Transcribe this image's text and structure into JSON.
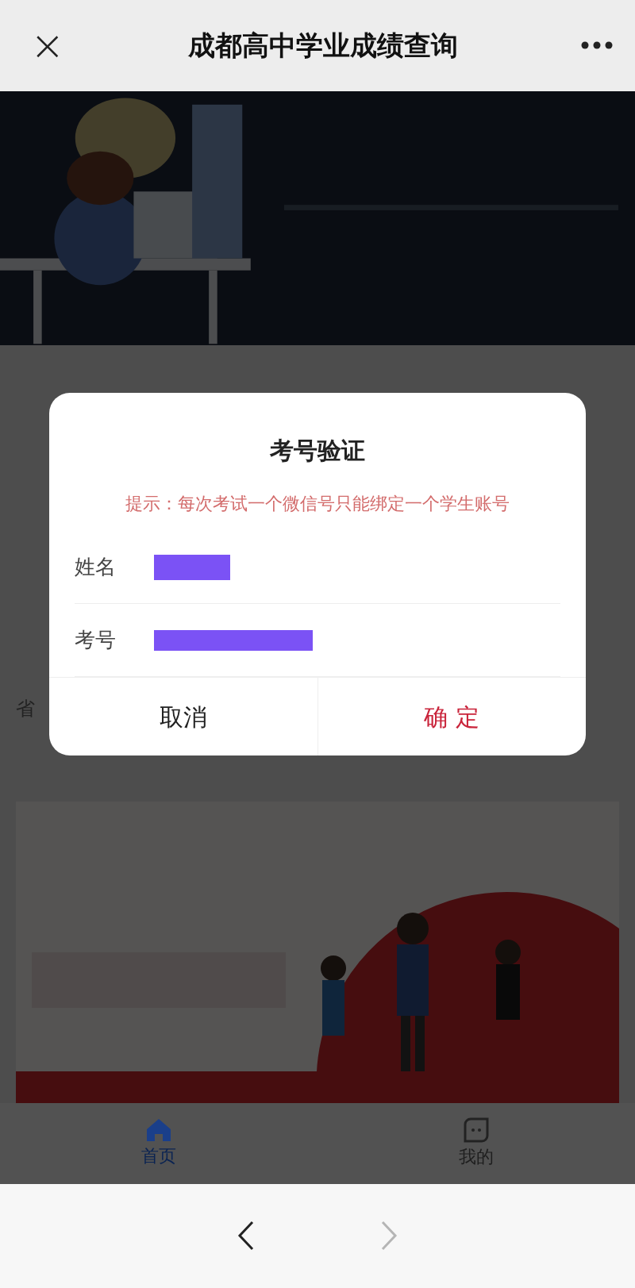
{
  "header": {
    "title": "成都高中学业成绩查询",
    "close": "×"
  },
  "background_text": [
    "省"
  ],
  "dialog": {
    "title": "考号验证",
    "hint": "提示：每次考试一个微信号只能绑定一个学生账号",
    "fields": [
      {
        "label": "姓名",
        "kind": "name",
        "redacted": true
      },
      {
        "label": "考号",
        "kind": "id",
        "redacted": true
      }
    ],
    "buttons": [
      {
        "label": "取消",
        "kind": "cancel"
      },
      {
        "label": "确 定",
        "kind": "confirm"
      }
    ]
  },
  "tabs": [
    {
      "label": "首页",
      "kind": "home",
      "selected": true
    },
    {
      "label": "我的",
      "kind": "chat",
      "selected": false
    }
  ],
  "nav": {
    "back_disabled": false,
    "forward_disabled": true
  }
}
